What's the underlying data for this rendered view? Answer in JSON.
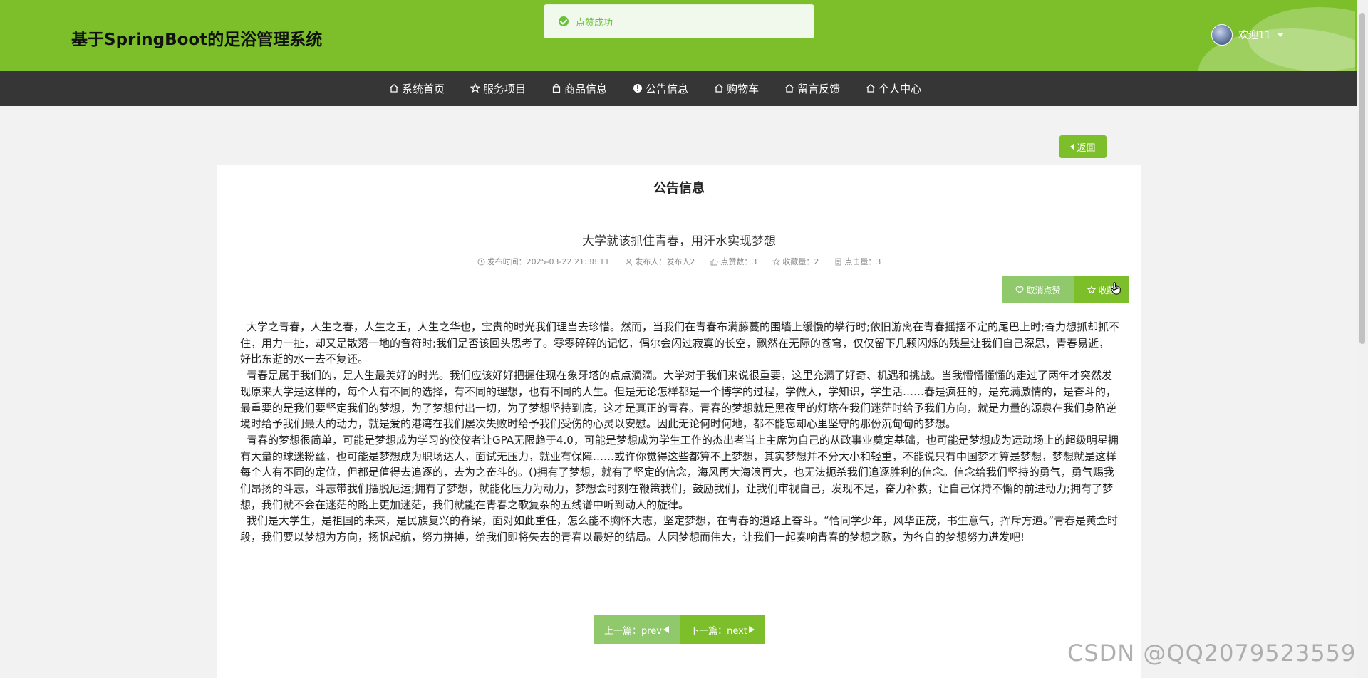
{
  "header": {
    "site_title": "基于SpringBoot的足浴管理系统",
    "user_name": "欢迎11"
  },
  "toast": {
    "message": "点赞成功"
  },
  "nav": {
    "items": [
      {
        "label": "系统首页",
        "icon": "home-icon"
      },
      {
        "label": "服务项目",
        "icon": "star-icon"
      },
      {
        "label": "商品信息",
        "icon": "bag-icon"
      },
      {
        "label": "公告信息",
        "icon": "info-icon"
      },
      {
        "label": "购物车",
        "icon": "home-icon"
      },
      {
        "label": "留言反馈",
        "icon": "home-icon"
      },
      {
        "label": "个人中心",
        "icon": "home-icon"
      }
    ]
  },
  "back_label": "返回",
  "page": {
    "section_title": "公告信息",
    "article_title": "大学就该抓住青春，用汗水实现梦想",
    "meta": {
      "publish_time": "发布时间：2025-03-22 21:38:11",
      "publisher": "发布人：发布人2",
      "likes": "点赞数：3",
      "favorites": "收藏量：2",
      "clicks": "点击量：3"
    },
    "unlike_label": "取消点赞",
    "favorite_label": "收藏",
    "paragraphs": [
      "大学之青春，人生之春，人生之王，人生之华也，宝贵的时光我们理当去珍惜。然而，当我们在青春布满藤蔓的围墙上缓慢的攀行时;依旧游离在青春摇摆不定的尾巴上时;奋力想抓却抓不住，用力一扯，却又是散落一地的音符时;我们是否该回头思考了。零零碎碎的记忆，偶尔会闪过寂寞的长空，飘然在无际的苍穹，仅仅留下几颗闪烁的残星让我们自己深思，青春易逝，好比东逝的水一去不复还。",
      "青春是属于我们的，是人生最美好的时光。我们应该好好把握住现在象牙塔的点点滴滴。大学对于我们来说很重要，这里充满了好奇、机遇和挑战。当我懵懵懂懂的走过了两年才突然发现原来大学是这样的，每个人有不同的选择，有不同的理想，也有不同的人生。但是无论怎样都是一个博学的过程，学做人，学知识，学生活……春是疯狂的，是充满激情的，是奋斗的，最重要的是我们要坚定我们的梦想，为了梦想付出一切，为了梦想坚持到底，这才是真正的青春。青春的梦想就是黑夜里的灯塔在我们迷茫时给予我们方向，就是力量的源泉在我们身陷逆境时给予我们最大的动力，就是爱的港湾在我们屡次失败时给予我们受伤的心灵以安慰。因此无论何时何地，都不能忘却心里坚守的那份沉甸甸的梦想。",
      "青春的梦想很简单，可能是梦想成为学习的佼佼者让GPA无限趋于4.0，可能是梦想成为学生工作的杰出者当上主席为自己的从政事业奠定基础，也可能是梦想成为运动场上的超级明星拥有大量的球迷粉丝，也可能是梦想成为职场达人，面试无压力，就业有保障……或许你觉得这些都算不上梦想，其实梦想并不分大小和轻重，不能说只有中国梦才算是梦想，梦想就是这样每个人有不同的定位，但都是值得去追逐的，去为之奋斗的。()拥有了梦想，就有了坚定的信念，海风再大海浪再大，也无法扼杀我们追逐胜利的信念。信念给我们坚持的勇气，勇气赐我们昂扬的斗志，斗志带我们摆脱厄运;拥有了梦想，就能化压力为动力，梦想会时刻在鞭策我们，鼓励我们，让我们审视自己，发现不足，奋力补救，让自己保持不懈的前进动力;拥有了梦想，我们就不会在迷茫的路上更加迷茫，我们就能在青春之歌复杂的五线谱中听到动人的旋律。",
      "我们是大学生，是祖国的未来，是民族复兴的脊梁，面对如此重任，怎么能不胸怀大志，坚定梦想，在青春的道路上奋斗。“恰同学少年，风华正茂，书生意气，挥斥方遒。”青春是黄金时段，我们要以梦想为方向，扬帆起航，努力拼搏，给我们即将失去的青春以最好的结局。人因梦想而伟大，让我们一起奏响青春的梦想之歌，为各自的梦想努力进发吧!"
    ],
    "prev_label": "上一篇：prev",
    "next_label": "下一篇：next"
  },
  "watermark": "CSDN @QQ2079523559",
  "colors": {
    "primary": "#7cbf2a",
    "light": "#8fc96b",
    "nav_bg": "#363636"
  }
}
